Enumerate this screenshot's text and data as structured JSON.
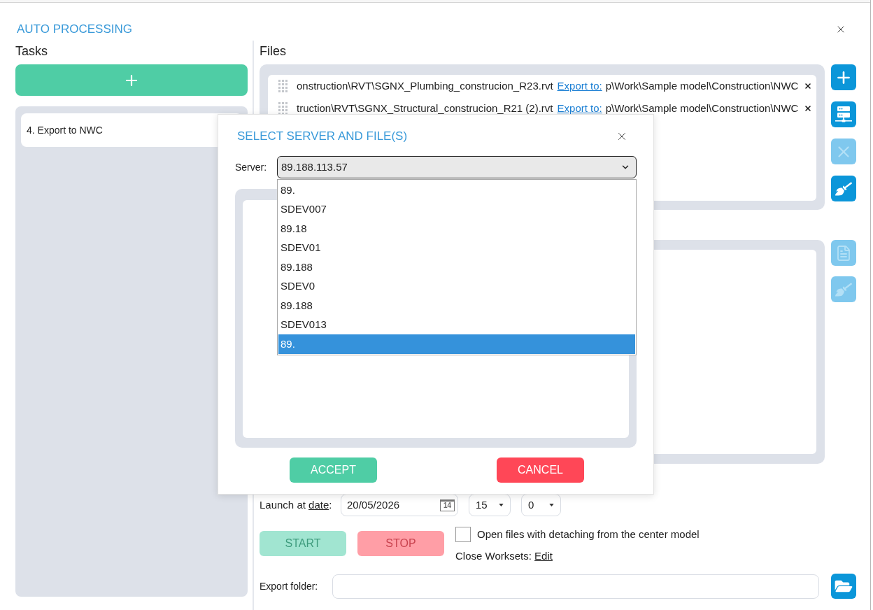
{
  "window": {
    "title": "AUTO PROCESSING"
  },
  "tasks": {
    "heading": "Tasks",
    "items": [
      {
        "label": "4. Export to NWC"
      }
    ]
  },
  "files": {
    "heading": "Files",
    "rows": [
      {
        "path": "onstruction\\RVT\\SGNX_Plumbing_construcion_R23.rvt",
        "export_label": "Export to:",
        "export_path": "p\\Work\\Sample model\\Construction\\NWC"
      },
      {
        "path": "truction\\RVT\\SGNX_Structural_construcion_R21 (2).rvt",
        "export_label": "Export to:",
        "export_path": "p\\Work\\Sample model\\Construction\\NWC"
      }
    ],
    "actions": [
      {
        "kind": "add",
        "disabled": false
      },
      {
        "kind": "server",
        "disabled": false
      },
      {
        "kind": "remove",
        "disabled": true
      },
      {
        "kind": "clear",
        "disabled": false
      }
    ]
  },
  "panel_2": {
    "actions": [
      {
        "kind": "document",
        "disabled": true
      },
      {
        "kind": "clear",
        "disabled": true
      }
    ]
  },
  "launch": {
    "text": "Launch at",
    "link": "date",
    "after": ":",
    "date": "20/05/2026",
    "calendar_day": "14",
    "hour": "15",
    "minute": "0"
  },
  "run": {
    "buttons": [
      {
        "kind": "start",
        "label": "START",
        "disabled": true
      },
      {
        "kind": "stop",
        "label": "STOP",
        "disabled": true
      }
    ],
    "detach": {
      "label": "Open files with detaching from the center model",
      "checked": false
    },
    "close_worksets": {
      "label": "Close Worksets:",
      "link": "Edit"
    }
  },
  "export_folder": {
    "label": "Export folder:"
  },
  "dialog": {
    "title": "SELECT SERVER AND FILE(S)",
    "server_label": "Server:",
    "server_value": "89.188.113.57",
    "expanded": true,
    "options": [
      {
        "label": "89.",
        "selected": false
      },
      {
        "label": "SDEV007",
        "selected": false
      },
      {
        "label": "89.18",
        "selected": false
      },
      {
        "label": "SDEV01",
        "selected": false
      },
      {
        "label": "89.188",
        "selected": false
      },
      {
        "label": "SDEV0",
        "selected": false
      },
      {
        "label": "89.188",
        "selected": false
      },
      {
        "label": "SDEV013",
        "selected": false
      },
      {
        "label": "89.",
        "selected": true
      }
    ],
    "buttons": [
      {
        "kind": "accept",
        "label": "ACCEPT"
      },
      {
        "kind": "cancel",
        "label": "CANCEL"
      }
    ]
  }
}
